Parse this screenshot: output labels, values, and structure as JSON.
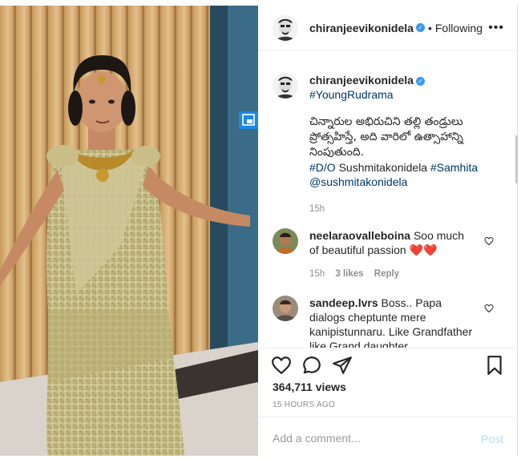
{
  "post": {
    "username": "chiranjeevikonidela",
    "follow_status": "Following",
    "more_icon": "more-icon",
    "verified": true
  },
  "caption": {
    "username": "chiranjeevikonidela",
    "hashtag_top": "#YoungRudrama",
    "text_line1": "చిన్నారుల అభిరుచిని తల్లి తండ్రులు",
    "text_line2": "ప్రోత్సహిస్తే, అది వారిలో ఉత్సాహాన్ని",
    "text_line3": "నింపుతుంది.",
    "tag_do": "#D/O",
    "mention_plain": "Sushmitakonidela",
    "hashtag_samhita": "#Samhita",
    "mention": "@sushmitakonidela",
    "time": "15h"
  },
  "comments": [
    {
      "username": "neelaraovalleboina",
      "text_a": "Soo much",
      "text_b": "of beautiful passion",
      "emoji": "❤️❤️",
      "time": "15h",
      "likes": "3 likes",
      "reply": "Reply"
    },
    {
      "username": "sandeep.lvrs",
      "text_a": "Boss.. Papa",
      "text_b": "dialogs cheptunte mere",
      "text_c": "kanipistunnaru. Like Grandfather",
      "text_d": "like Grand daughter"
    }
  ],
  "actions": {
    "like_icon": "heart-icon",
    "comment_icon": "comment-icon",
    "share_icon": "share-icon",
    "save_icon": "bookmark-icon"
  },
  "stats": {
    "views": "364,711 views",
    "time_ago": "15 HOURS AGO"
  },
  "add_comment": {
    "placeholder": "Add a comment...",
    "post_label": "Post"
  },
  "colors": {
    "link": "#003569",
    "verified_blue": "#3897f0",
    "post_disabled": "#b2dffc",
    "secondary_text": "#8e8e8e",
    "heart_red": "#ed4956"
  }
}
